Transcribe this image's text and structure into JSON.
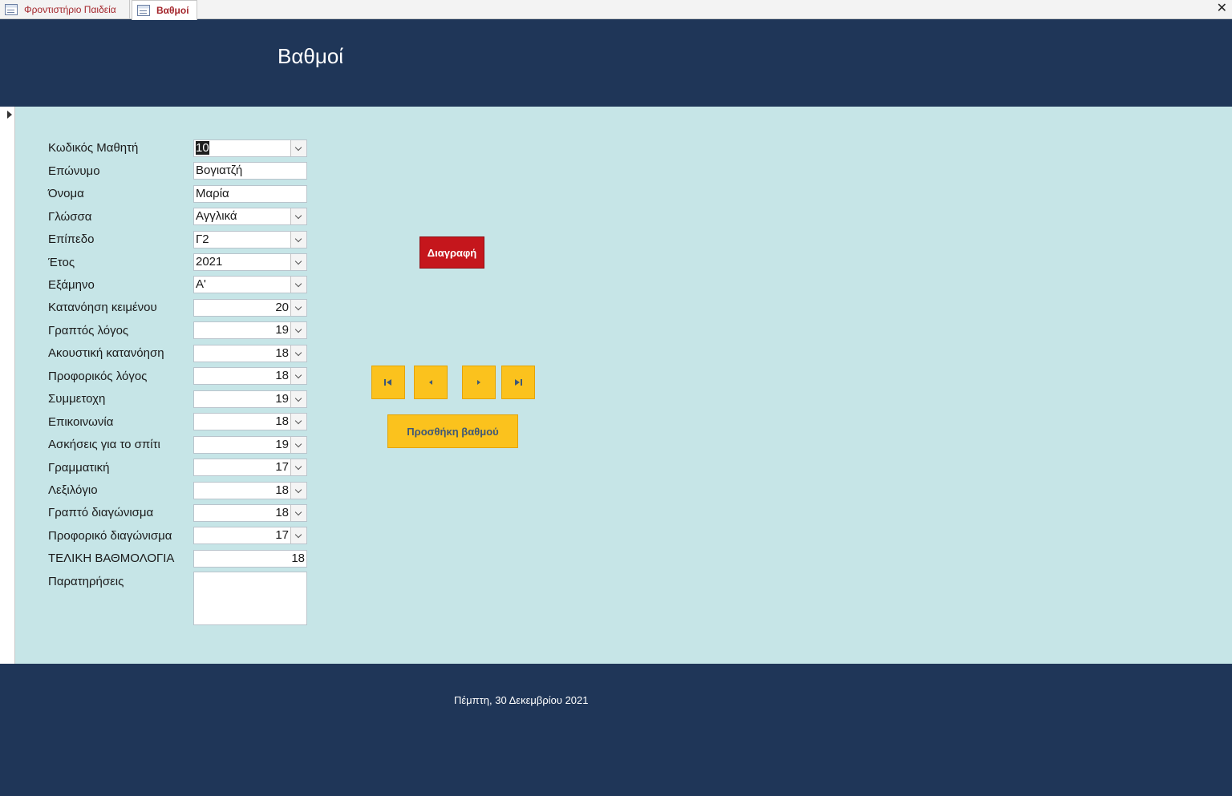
{
  "tabs": [
    {
      "label": "Φροντιστήριο Παιδεία"
    },
    {
      "label": "Βαθμοί"
    }
  ],
  "header": {
    "title": "Βαθμοί"
  },
  "form": {
    "fields": [
      {
        "label": "Κωδικός Μαθητή",
        "value": "10"
      },
      {
        "label": "Επώνυμο",
        "value": "Βογιατζή"
      },
      {
        "label": "Όνομα",
        "value": "Μαρία"
      },
      {
        "label": "Γλώσσα",
        "value": "Αγγλικά"
      },
      {
        "label": "Επίπεδο",
        "value": "Γ2"
      },
      {
        "label": "Έτος",
        "value": "2021"
      },
      {
        "label": "Εξάμηνο",
        "value": "Α'"
      },
      {
        "label": "Κατανόηση κειμένου",
        "value": "20"
      },
      {
        "label": "Γραπτός λόγος",
        "value": "19"
      },
      {
        "label": "Ακουστική κατανόηση",
        "value": "18"
      },
      {
        "label": "Προφορικός λόγος",
        "value": "18"
      },
      {
        "label": "Συμμετοχη",
        "value": "19"
      },
      {
        "label": "Επικοινωνία",
        "value": "18"
      },
      {
        "label": "Ασκήσεις για το σπίτι",
        "value": "19"
      },
      {
        "label": "Γραμματική",
        "value": "17"
      },
      {
        "label": "Λεξιλόγιο",
        "value": "18"
      },
      {
        "label": "Γραπτό διαγώνισμα",
        "value": "18"
      },
      {
        "label": "Προφορικό διαγώνισμα",
        "value": "17"
      },
      {
        "label": "ΤΕΛΙΚΗ ΒΑΘΜΟΛΟΓΙΑ",
        "value": "18"
      },
      {
        "label": "Παρατηρήσεις",
        "value": ""
      }
    ]
  },
  "buttons": {
    "delete_label": "Διαγραφή",
    "add_grade_label": "Προσθήκη βαθμού"
  },
  "icons": {
    "first": "first-record-icon",
    "previous": "previous-record-icon",
    "next": "next-record-icon",
    "last": "last-record-icon"
  },
  "footer": {
    "date": "Πέμπτη, 30 Δεκεμβρίου 2021"
  },
  "colors": {
    "header_bg": "#1f3658",
    "detail_bg": "#c6e5e7",
    "delete_button": "#c5161c",
    "nav_button": "#fbc21d"
  }
}
